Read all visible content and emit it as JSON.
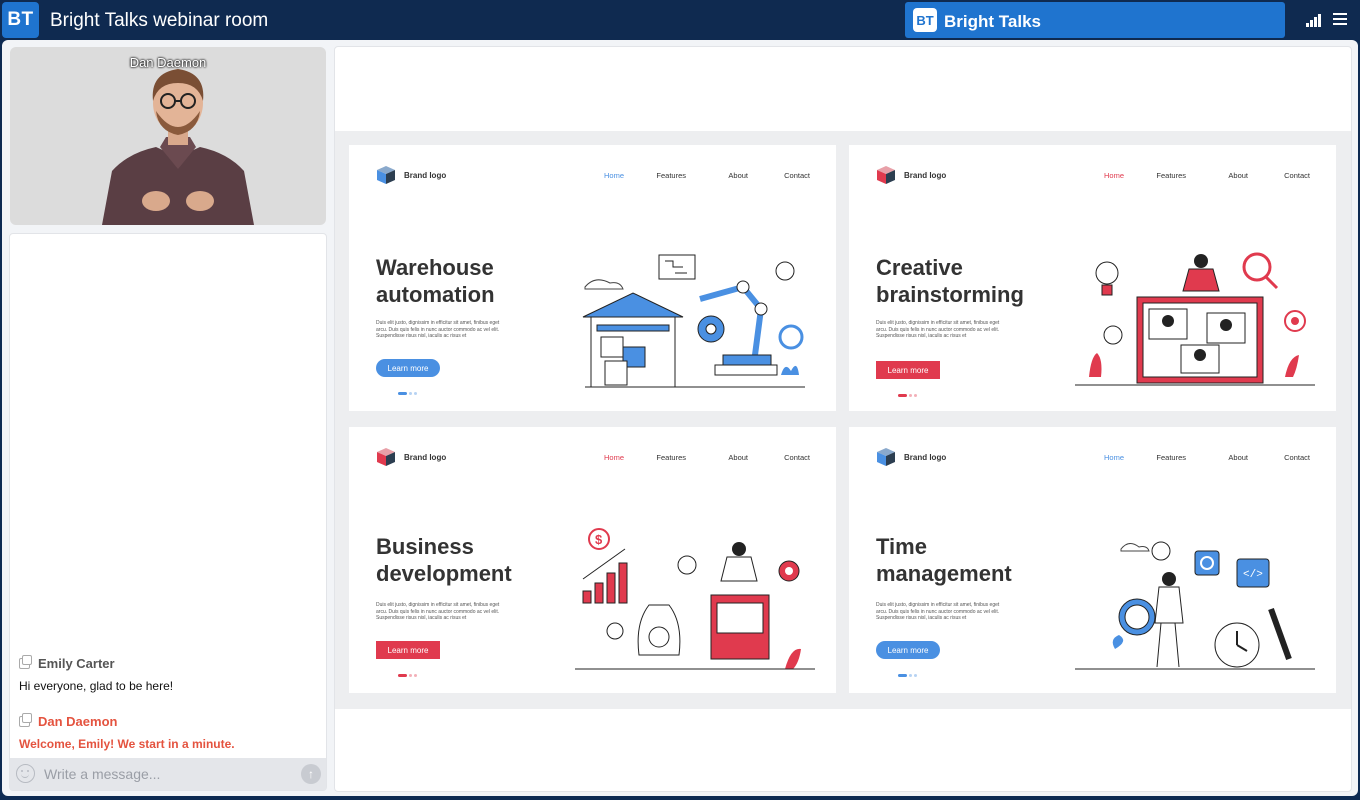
{
  "app": {
    "badge": "BT",
    "title": "Bright Talks webinar room",
    "brand_badge": "BT",
    "brand_name": "Bright Talks"
  },
  "video": {
    "speaker_name": "Dan Daemon"
  },
  "chat": {
    "messages": [
      {
        "author": "Emily Carter",
        "text": "Hi everyone, glad to be here!"
      },
      {
        "author": "Dan Daemon",
        "text": "Welcome, Emily! We start in a minute."
      }
    ],
    "placeholder": "Write a message..."
  },
  "slides": [
    {
      "brand": "Brand logo",
      "nav": [
        "Home",
        "Features",
        "About",
        "Contact"
      ],
      "title_line1": "Warehouse",
      "title_line2": "automation",
      "body": "Duis elit justo, dignissim in efficitur sit amet, finibus eget arcu. Duis quis felis in nunc auctor commodo ac vel elit. Suspendisse risus nisl, iaculis ac risus et",
      "button": "Learn more",
      "accent": "#4a90e2"
    },
    {
      "brand": "Brand logo",
      "nav": [
        "Home",
        "Features",
        "About",
        "Contact"
      ],
      "title_line1": "Creative",
      "title_line2": "brainstorming",
      "body": "Duis elit justo, dignissim in efficitur sit amet, finibus eget arcu. Duis quis felis in nunc auctor commodo ac vel elit. Suspendisse risus nisl, iaculis ac risus et",
      "button": "Learn more",
      "accent": "#e03a4e"
    },
    {
      "brand": "Brand logo",
      "nav": [
        "Home",
        "Features",
        "About",
        "Contact"
      ],
      "title_line1": "Business",
      "title_line2": "development",
      "body": "Duis elit justo, dignissim in efficitur sit amet, finibus eget arcu. Duis quis felis in nunc auctor commodo ac vel elit. Suspendisse risus nisl, iaculis ac risus et",
      "button": "Learn more",
      "accent": "#e03a4e"
    },
    {
      "brand": "Brand logo",
      "nav": [
        "Home",
        "Features",
        "About",
        "Contact"
      ],
      "title_line1": "Time",
      "title_line2": "management",
      "body": "Duis elit justo, dignissim in efficitur sit amet, finibus eget arcu. Duis quis felis in nunc auctor commodo ac vel elit. Suspendisse risus nisl, iaculis ac risus et",
      "button": "Learn more",
      "accent": "#4a90e2"
    }
  ],
  "icons": {
    "signal": "signal-bars-icon",
    "menu": "hamburger-menu-icon",
    "emoji": "emoji-icon",
    "send": "send-arrow-icon",
    "copy": "copy-icon"
  },
  "colors": {
    "topbar": "#0f2a50",
    "brand_blue": "#1f74cf",
    "host_red": "#e4533f"
  }
}
